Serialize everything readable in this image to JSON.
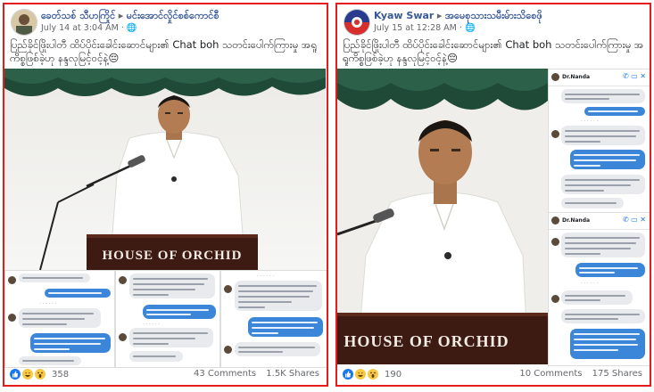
{
  "posts": [
    {
      "author": "ခေတ်သစ် သီဟကြိုင်",
      "group": "မင်းအောင်လှိုင်စစ်ကောင်စီ",
      "timestamp": "July 14 at 3:04 AM",
      "privacy_icon": "globe-icon",
      "caption": "ပြည်ခိုင်ဖြိုးပါတီ ထိပ်ပိုင်းခေါင်းဆောင်များ၏ Chat boh သတင်းပေါက်ကြားမှု အရူကိစ္စဖြစ်ခဲ့ဟု နန္ဒလုမြင့်ဝင့်နဲ့😔",
      "podium_text": "HOUSE OF ORCHID",
      "reactions": [
        "like-icon",
        "haha-icon",
        "wow-icon"
      ],
      "reaction_count": "358",
      "comments": "43 Comments",
      "shares": "1.5K Shares"
    },
    {
      "author": "Kyaw Swar",
      "group": "အမေစုသားသမီးမ်ားသိစေဖို",
      "timestamp": "July 15 at 12:28 AM",
      "privacy_icon": "globe-icon",
      "caption": "ပြည်ခိုင်ဖြိုးပါတီ ထိပ်ပိုင်းခေါင်းဆောင်များ၏ Chat boh သတင်းပေါက်ကြားမှု အရူကိစ္စဖြစ်ခဲ့ဟု နန္ဒလုမြင့်ဝင့်နဲ့😔",
      "podium_text": "HOUSE OF ORCHID",
      "reactions": [
        "like-icon",
        "haha-icon",
        "wow-icon"
      ],
      "reaction_count": "190",
      "comments": "10 Comments",
      "shares": "175 Shares",
      "chat_name": "Dr.Nanda"
    }
  ],
  "colors": {
    "frame": "#e41c1c",
    "link": "#385898",
    "bubble": "#3b86d9"
  }
}
